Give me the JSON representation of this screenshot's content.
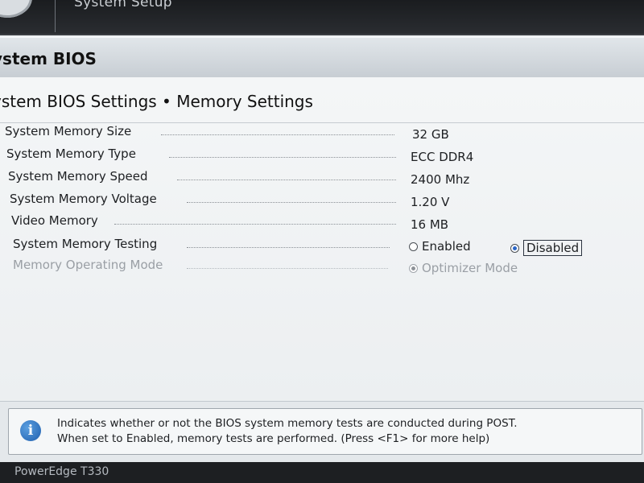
{
  "header": {
    "title": "System Setup"
  },
  "section": {
    "title": "ystem BIOS"
  },
  "page": {
    "title": "ystem BIOS Settings • Memory Settings"
  },
  "settings": [
    {
      "label": "System Memory Size",
      "value": "32 GB"
    },
    {
      "label": "System Memory Type",
      "value": "ECC DDR4"
    },
    {
      "label": "System Memory Speed",
      "value": "2400 Mhz"
    },
    {
      "label": "System Memory Voltage",
      "value": "1.20 V"
    },
    {
      "label": "Video Memory",
      "value": "16 MB"
    }
  ],
  "memory_testing": {
    "label": "System Memory Testing",
    "options": [
      "Enabled",
      "Disabled"
    ],
    "selected": "Disabled"
  },
  "operating_mode": {
    "label": "Memory Operating Mode",
    "options": [
      "Optimizer Mode"
    ],
    "selected": "Optimizer Mode",
    "enabled": false
  },
  "help": {
    "line1": "Indicates whether or not the BIOS system memory tests are conducted during POST.",
    "line2": "When set to Enabled, memory tests are performed. (Press <F1> for more help)",
    "icon": "info-icon"
  },
  "footer": {
    "model": "PowerEdge T330"
  },
  "colors": {
    "accent": "#2a66c8",
    "header_bg": "#1a1c1f",
    "info_icon": "#1f5fae"
  }
}
